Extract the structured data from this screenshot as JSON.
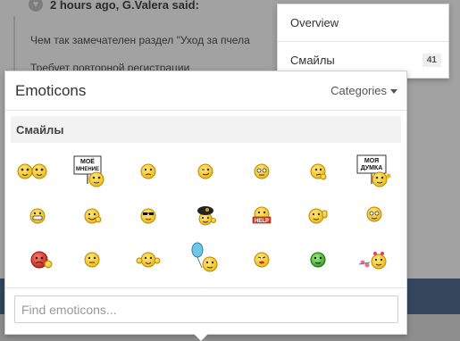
{
  "background_post": {
    "header": "2 hours ago, G.Valera said:",
    "line1": "Чем так замечателен раздел \"Уход за пчела",
    "line2": "Требует повторной регистрации"
  },
  "overview_menu": {
    "items": [
      {
        "label": "Overview",
        "count": ""
      },
      {
        "label": "Смайлы",
        "count": "41"
      }
    ]
  },
  "emoticons": {
    "title": "Emoticons",
    "categories_label": "Categories",
    "section": "Смайлы",
    "search_placeholder": "Find emoticons...",
    "sign1": [
      "МОЁ",
      "МНЕНИЕ"
    ],
    "sign2": [
      "МОЯ",
      "ДУМКА"
    ],
    "help_badge": "HELP"
  },
  "colors": {
    "smiley_yellow": "#f3c21b",
    "smiley_outline": "#b98a08",
    "overlay": "#a2a2a2",
    "navy_bar": "#34475c"
  }
}
